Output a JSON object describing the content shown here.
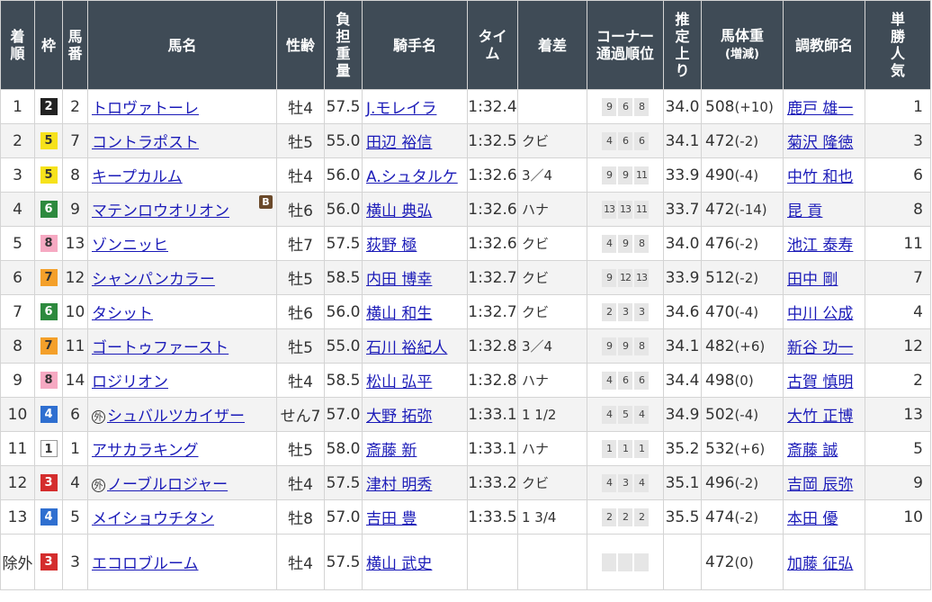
{
  "headers": {
    "rank": [
      "着",
      "順"
    ],
    "waku": "枠",
    "umaban": [
      "馬",
      "番"
    ],
    "horse": "馬名",
    "sexage": "性齢",
    "weight": [
      "負",
      "担",
      "重",
      "量"
    ],
    "jockey": "騎手名",
    "time": [
      "タイ",
      "ム"
    ],
    "margin": "着差",
    "corner": [
      "コーナー",
      "通過順位"
    ],
    "last3f": [
      "推",
      "定",
      "上",
      "り"
    ],
    "bodyweight": [
      "馬体重",
      "(増減)"
    ],
    "trainer": "調教師名",
    "popularity": [
      "単",
      "勝",
      "人",
      "気"
    ]
  },
  "colors": {
    "header_bg": "#3f4b56",
    "link": "#1b1bb8"
  },
  "rows": [
    {
      "rank": "1",
      "waku": "2",
      "umaban": "2",
      "mark": "",
      "blinker": "",
      "horse": "トロヴァトーレ",
      "sexage": "牡4",
      "weight": "57.5",
      "jockey": "J.モレイラ",
      "time": "1:32.4",
      "margin": "",
      "corner": [
        "9",
        "6",
        "8"
      ],
      "last3f": "34.0",
      "bw": "508",
      "bwdiff": "(+10)",
      "trainer": "鹿戸 雄一",
      "pop": "1"
    },
    {
      "rank": "2",
      "waku": "5",
      "umaban": "7",
      "mark": "",
      "blinker": "",
      "horse": "コントラポスト",
      "sexage": "牡5",
      "weight": "55.0",
      "jockey": "田辺 裕信",
      "time": "1:32.5",
      "margin": "クビ",
      "corner": [
        "4",
        "6",
        "6"
      ],
      "last3f": "34.1",
      "bw": "472",
      "bwdiff": "(-2)",
      "trainer": "菊沢 隆徳",
      "pop": "3"
    },
    {
      "rank": "3",
      "waku": "5",
      "umaban": "8",
      "mark": "",
      "blinker": "",
      "horse": "キープカルム",
      "sexage": "牡4",
      "weight": "56.0",
      "jockey": "A.シュタルケ",
      "time": "1:32.6",
      "margin": "3／4",
      "corner": [
        "9",
        "9",
        "11"
      ],
      "last3f": "33.9",
      "bw": "490",
      "bwdiff": "(-4)",
      "trainer": "中竹 和也",
      "pop": "6"
    },
    {
      "rank": "4",
      "waku": "6",
      "umaban": "9",
      "mark": "",
      "blinker": "B",
      "horse": "マテンロウオリオン",
      "sexage": "牡6",
      "weight": "56.0",
      "jockey": "横山 典弘",
      "time": "1:32.6",
      "margin": "ハナ",
      "corner": [
        "13",
        "13",
        "11"
      ],
      "last3f": "33.7",
      "bw": "472",
      "bwdiff": "(-14)",
      "trainer": "昆 貢",
      "pop": "8"
    },
    {
      "rank": "5",
      "waku": "8",
      "umaban": "13",
      "mark": "",
      "blinker": "",
      "horse": "ゾンニッヒ",
      "sexage": "牡7",
      "weight": "57.5",
      "jockey": "荻野 極",
      "time": "1:32.6",
      "margin": "クビ",
      "corner": [
        "4",
        "9",
        "8"
      ],
      "last3f": "34.0",
      "bw": "476",
      "bwdiff": "(-2)",
      "trainer": "池江 泰寿",
      "pop": "11"
    },
    {
      "rank": "6",
      "waku": "7",
      "umaban": "12",
      "mark": "",
      "blinker": "",
      "horse": "シャンパンカラー",
      "sexage": "牡5",
      "weight": "58.5",
      "jockey": "内田 博幸",
      "time": "1:32.7",
      "margin": "クビ",
      "corner": [
        "9",
        "12",
        "13"
      ],
      "last3f": "33.9",
      "bw": "512",
      "bwdiff": "(-2)",
      "trainer": "田中 剛",
      "pop": "7"
    },
    {
      "rank": "7",
      "waku": "6",
      "umaban": "10",
      "mark": "",
      "blinker": "",
      "horse": "タシット",
      "sexage": "牡6",
      "weight": "56.0",
      "jockey": "横山 和生",
      "time": "1:32.7",
      "margin": "クビ",
      "corner": [
        "2",
        "3",
        "3"
      ],
      "last3f": "34.6",
      "bw": "470",
      "bwdiff": "(-4)",
      "trainer": "中川 公成",
      "pop": "4"
    },
    {
      "rank": "8",
      "waku": "7",
      "umaban": "11",
      "mark": "",
      "blinker": "",
      "horse": "ゴートゥファースト",
      "sexage": "牡5",
      "weight": "55.0",
      "jockey": "石川 裕紀人",
      "time": "1:32.8",
      "margin": "3／4",
      "corner": [
        "9",
        "9",
        "8"
      ],
      "last3f": "34.1",
      "bw": "482",
      "bwdiff": "(+6)",
      "trainer": "新谷 功一",
      "pop": "12"
    },
    {
      "rank": "9",
      "waku": "8",
      "umaban": "14",
      "mark": "",
      "blinker": "",
      "horse": "ロジリオン",
      "sexage": "牡4",
      "weight": "58.5",
      "jockey": "松山 弘平",
      "time": "1:32.8",
      "margin": "ハナ",
      "corner": [
        "4",
        "6",
        "6"
      ],
      "last3f": "34.4",
      "bw": "498",
      "bwdiff": "(0)",
      "trainer": "古賀 慎明",
      "pop": "2"
    },
    {
      "rank": "10",
      "waku": "4",
      "umaban": "6",
      "mark": "外",
      "blinker": "",
      "horse": "シュバルツカイザー",
      "sexage": "せん7",
      "weight": "57.0",
      "jockey": "大野 拓弥",
      "time": "1:33.1",
      "margin": "1 1/2",
      "corner": [
        "4",
        "5",
        "4"
      ],
      "last3f": "34.9",
      "bw": "502",
      "bwdiff": "(-4)",
      "trainer": "大竹 正博",
      "pop": "13"
    },
    {
      "rank": "11",
      "waku": "1",
      "umaban": "1",
      "mark": "",
      "blinker": "",
      "horse": "アサカラキング",
      "sexage": "牡5",
      "weight": "58.0",
      "jockey": "斎藤 新",
      "time": "1:33.1",
      "margin": "ハナ",
      "corner": [
        "1",
        "1",
        "1"
      ],
      "last3f": "35.2",
      "bw": "532",
      "bwdiff": "(+6)",
      "trainer": "斎藤 誠",
      "pop": "5"
    },
    {
      "rank": "12",
      "waku": "3",
      "umaban": "4",
      "mark": "外",
      "blinker": "",
      "horse": "ノーブルロジャー",
      "sexage": "牡4",
      "weight": "57.5",
      "jockey": "津村 明秀",
      "time": "1:33.2",
      "margin": "クビ",
      "corner": [
        "4",
        "3",
        "4"
      ],
      "last3f": "35.1",
      "bw": "496",
      "bwdiff": "(-2)",
      "trainer": "吉岡 辰弥",
      "pop": "9"
    },
    {
      "rank": "13",
      "waku": "4",
      "umaban": "5",
      "mark": "",
      "blinker": "",
      "horse": "メイショウチタン",
      "sexage": "牡8",
      "weight": "57.0",
      "jockey": "吉田 豊",
      "time": "1:33.5",
      "margin": "1 3/4",
      "corner": [
        "2",
        "2",
        "2"
      ],
      "last3f": "35.5",
      "bw": "474",
      "bwdiff": "(-2)",
      "trainer": "本田 優",
      "pop": "10"
    },
    {
      "rank": "除外",
      "waku": "3",
      "umaban": "3",
      "mark": "",
      "blinker": "",
      "horse": "エコロブルーム",
      "sexage": "牡4",
      "weight": "57.5",
      "jockey": "横山 武史",
      "time": "",
      "margin": "",
      "corner": [
        "",
        "",
        ""
      ],
      "last3f": "",
      "bw": "472",
      "bwdiff": "(0)",
      "trainer": "加藤 征弘",
      "pop": ""
    }
  ]
}
